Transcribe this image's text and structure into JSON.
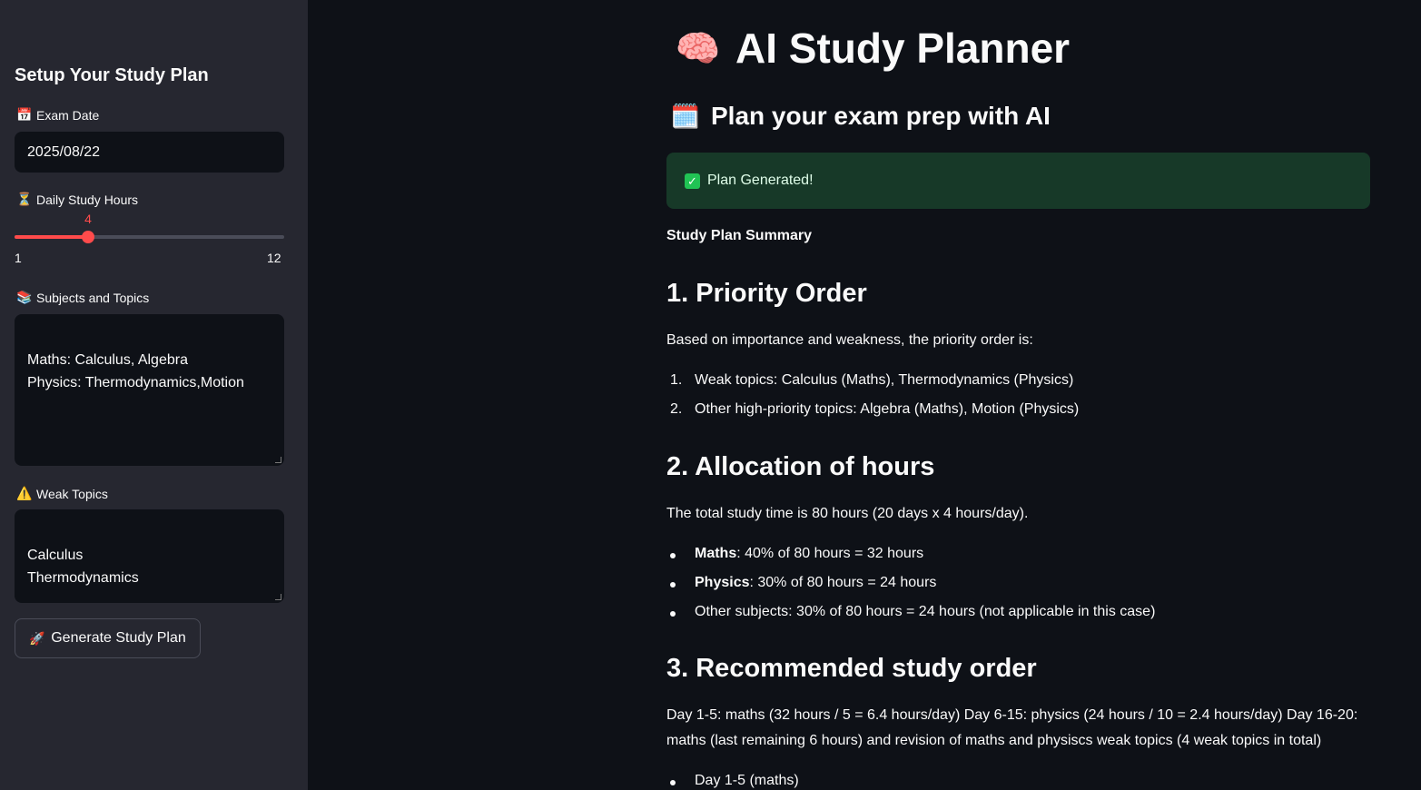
{
  "sidebar": {
    "title": "Setup Your Study Plan",
    "exam_date": {
      "icon": "calendar-icon",
      "label": "Exam Date",
      "value": "2025/08/22"
    },
    "daily_hours": {
      "icon": "hourglass-icon",
      "label": "Daily Study Hours",
      "value": "4",
      "min": "1",
      "max": "12",
      "fraction": 0.2727
    },
    "subjects": {
      "icon": "books-icon",
      "label": "Subjects and Topics",
      "value": "Maths: Calculus, Algebra\nPhysics: Thermodynamics,Motion"
    },
    "weak_topics": {
      "icon": "warning-icon",
      "label": "Weak Topics",
      "value": "Calculus\nThermodynamics"
    },
    "generate_button": {
      "icon": "rocket-icon",
      "label": "Generate Study Plan"
    }
  },
  "main": {
    "title_icon": "brain-icon",
    "title": "AI Study Planner",
    "subtitle_icon": "calendar-icon",
    "subtitle": "Plan your exam prep with AI",
    "success_message": "Plan Generated!",
    "summary_label": "Study Plan Summary",
    "section1": {
      "heading": "1. Priority Order",
      "intro": "Based on importance and weakness, the priority order is:",
      "items": [
        {
          "marker": "1.",
          "text": "Weak topics: Calculus (Maths), Thermodynamics (Physics)"
        },
        {
          "marker": "2.",
          "text": "Other high-priority topics: Algebra (Maths), Motion (Physics)"
        }
      ]
    },
    "section2": {
      "heading": "2. Allocation of hours",
      "intro": "The total study time is 80 hours (20 days x 4 hours/day).",
      "items": [
        {
          "bold": "Maths",
          "rest": ": 40% of 80 hours = 32 hours"
        },
        {
          "bold": "Physics",
          "rest": ": 30% of 80 hours = 24 hours"
        },
        {
          "bold": "",
          "rest": "Other subjects: 30% of 80 hours = 24 hours (not applicable in this case)"
        }
      ]
    },
    "section3": {
      "heading": "3. Recommended study order",
      "paragraph_line1": "Day 1-5: maths (32 hours / 5 = 6.4 hours/day) Day 6-15: physics (24 hours / 10 = 2.4 hours/day) Day 16-20:",
      "paragraph_line2": "maths (last remaining 6 hours) and revision of maths and physiscs weak topics (4 weak topics in total)",
      "items": [
        {
          "text": "Day 1-5 (maths)"
        }
      ]
    }
  },
  "colors": {
    "accent": "#ff4b4b",
    "success_bg": "#173928",
    "sidebar_bg": "#262730",
    "page_bg": "#0e1117"
  }
}
